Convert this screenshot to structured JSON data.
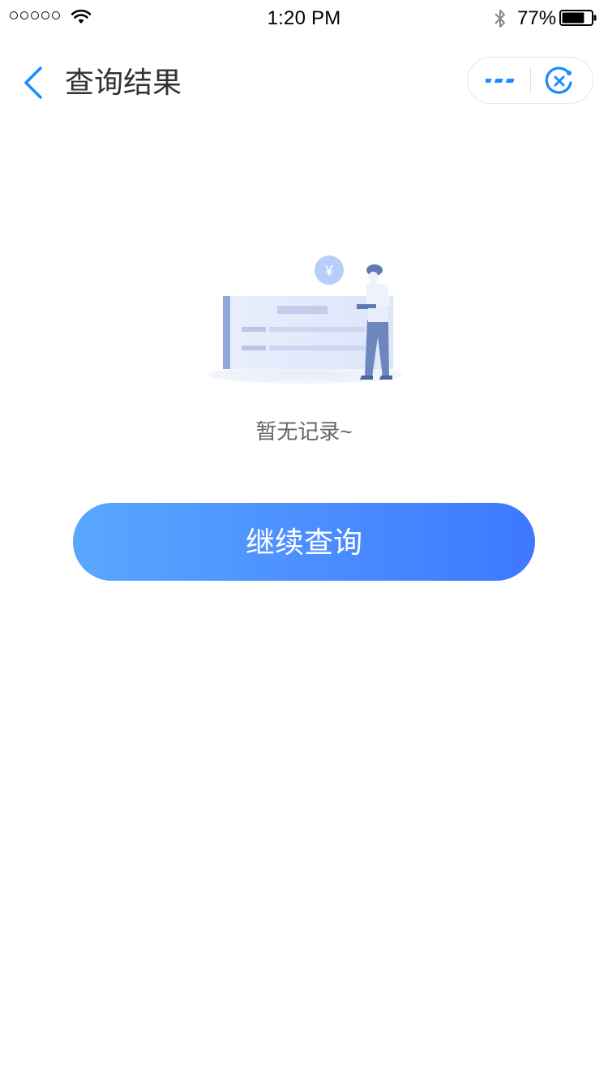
{
  "status_bar": {
    "time": "1:20 PM",
    "battery_percent": "77%",
    "battery_level": 0.77
  },
  "nav": {
    "title": "查询结果",
    "back_icon": "chevron-left-icon",
    "more_icon": "more-dots-icon",
    "close_icon": "close-target-icon"
  },
  "empty_state": {
    "illustration": "empty-record-illustration",
    "currency_symbol": "¥",
    "message": "暂无记录~"
  },
  "actions": {
    "continue_label": "继续查询"
  },
  "colors": {
    "accent": "#1a8cff",
    "button_gradient_start": "#5aa7ff",
    "button_gradient_end": "#3d78ff",
    "title_text": "#333333",
    "muted_text": "#666666"
  }
}
